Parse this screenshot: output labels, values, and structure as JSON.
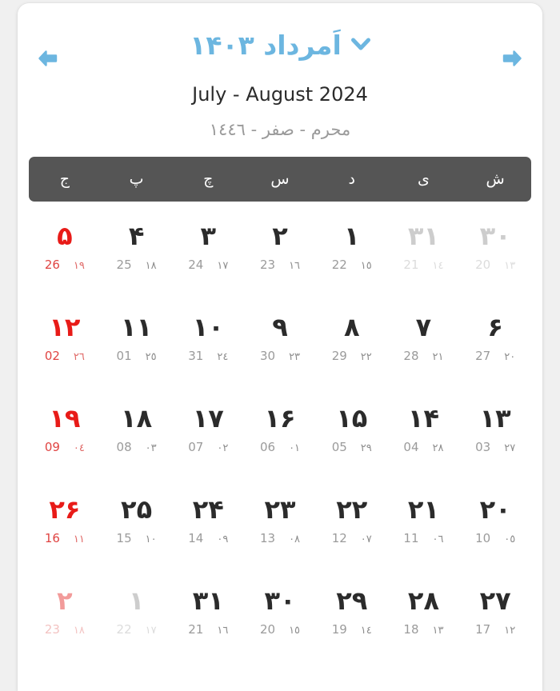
{
  "theme": {
    "page_background": "#f0f0f0",
    "card_background": "#ffffff",
    "accent": "#6cb6e0",
    "weekbar_background": "#555555",
    "holiday": "#e81b18",
    "muted": "#cdcdcd"
  },
  "header": {
    "prev_icon": "arrow-left-icon",
    "next_icon": "arrow-right-icon",
    "dropdown_icon": "chevron-down-icon",
    "title": "اَمرداد ۱۴۰۳",
    "gregorian_range": "July - August 2024",
    "hijri_range": "محرم - صفر - ١٤٤٦"
  },
  "weekdays": [
    {
      "label": "ش",
      "name": "shanbeh"
    },
    {
      "label": "ی",
      "name": "yekshanbeh"
    },
    {
      "label": "د",
      "name": "doshanbeh"
    },
    {
      "label": "س",
      "name": "seshanbeh"
    },
    {
      "label": "چ",
      "name": "chaharshanbeh"
    },
    {
      "label": "پ",
      "name": "panjshanbeh"
    },
    {
      "label": "ج",
      "name": "jomeh"
    }
  ],
  "weeks": [
    [
      {
        "jalali": "۳۰",
        "hijri": "١٣",
        "greg": "20",
        "muted": true,
        "holiday": false
      },
      {
        "jalali": "۳۱",
        "hijri": "١٤",
        "greg": "21",
        "muted": true,
        "holiday": false
      },
      {
        "jalali": "۱",
        "hijri": "١٥",
        "greg": "22",
        "muted": false,
        "holiday": false
      },
      {
        "jalali": "۲",
        "hijri": "١٦",
        "greg": "23",
        "muted": false,
        "holiday": false
      },
      {
        "jalali": "۳",
        "hijri": "١٧",
        "greg": "24",
        "muted": false,
        "holiday": false
      },
      {
        "jalali": "۴",
        "hijri": "١٨",
        "greg": "25",
        "muted": false,
        "holiday": false
      },
      {
        "jalali": "۵",
        "hijri": "١٩",
        "greg": "26",
        "muted": false,
        "holiday": true
      }
    ],
    [
      {
        "jalali": "۶",
        "hijri": "٢٠",
        "greg": "27",
        "muted": false,
        "holiday": false
      },
      {
        "jalali": "۷",
        "hijri": "٢١",
        "greg": "28",
        "muted": false,
        "holiday": false
      },
      {
        "jalali": "۸",
        "hijri": "٢٢",
        "greg": "29",
        "muted": false,
        "holiday": false
      },
      {
        "jalali": "۹",
        "hijri": "٢٣",
        "greg": "30",
        "muted": false,
        "holiday": false
      },
      {
        "jalali": "۱۰",
        "hijri": "٢٤",
        "greg": "31",
        "muted": false,
        "holiday": false
      },
      {
        "jalali": "۱۱",
        "hijri": "٢٥",
        "greg": "01",
        "muted": false,
        "holiday": false
      },
      {
        "jalali": "۱۲",
        "hijri": "٢٦",
        "greg": "02",
        "muted": false,
        "holiday": true
      }
    ],
    [
      {
        "jalali": "۱۳",
        "hijri": "٢٧",
        "greg": "03",
        "muted": false,
        "holiday": false
      },
      {
        "jalali": "۱۴",
        "hijri": "٢٨",
        "greg": "04",
        "muted": false,
        "holiday": false
      },
      {
        "jalali": "۱۵",
        "hijri": "٢٩",
        "greg": "05",
        "muted": false,
        "holiday": false
      },
      {
        "jalali": "۱۶",
        "hijri": "٠١",
        "greg": "06",
        "muted": false,
        "holiday": false
      },
      {
        "jalali": "۱۷",
        "hijri": "٠٢",
        "greg": "07",
        "muted": false,
        "holiday": false
      },
      {
        "jalali": "۱۸",
        "hijri": "٠٣",
        "greg": "08",
        "muted": false,
        "holiday": false
      },
      {
        "jalali": "۱۹",
        "hijri": "٠٤",
        "greg": "09",
        "muted": false,
        "holiday": true
      }
    ],
    [
      {
        "jalali": "۲۰",
        "hijri": "٠٥",
        "greg": "10",
        "muted": false,
        "holiday": false
      },
      {
        "jalali": "۲۱",
        "hijri": "٠٦",
        "greg": "11",
        "muted": false,
        "holiday": false
      },
      {
        "jalali": "۲۲",
        "hijri": "٠٧",
        "greg": "12",
        "muted": false,
        "holiday": false
      },
      {
        "jalali": "۲۳",
        "hijri": "٠٨",
        "greg": "13",
        "muted": false,
        "holiday": false
      },
      {
        "jalali": "۲۴",
        "hijri": "٠٩",
        "greg": "14",
        "muted": false,
        "holiday": false
      },
      {
        "jalali": "۲۵",
        "hijri": "١٠",
        "greg": "15",
        "muted": false,
        "holiday": false
      },
      {
        "jalali": "۲۶",
        "hijri": "١١",
        "greg": "16",
        "muted": false,
        "holiday": true
      }
    ],
    [
      {
        "jalali": "۲۷",
        "hijri": "١٢",
        "greg": "17",
        "muted": false,
        "holiday": false
      },
      {
        "jalali": "۲۸",
        "hijri": "١٣",
        "greg": "18",
        "muted": false,
        "holiday": false
      },
      {
        "jalali": "۲۹",
        "hijri": "١٤",
        "greg": "19",
        "muted": false,
        "holiday": false
      },
      {
        "jalali": "۳۰",
        "hijri": "١٥",
        "greg": "20",
        "muted": false,
        "holiday": false
      },
      {
        "jalali": "۳۱",
        "hijri": "١٦",
        "greg": "21",
        "muted": false,
        "holiday": false
      },
      {
        "jalali": "۱",
        "hijri": "١٧",
        "greg": "22",
        "muted": true,
        "holiday": false
      },
      {
        "jalali": "۲",
        "hijri": "١٨",
        "greg": "23",
        "muted": true,
        "holiday": true
      }
    ]
  ]
}
